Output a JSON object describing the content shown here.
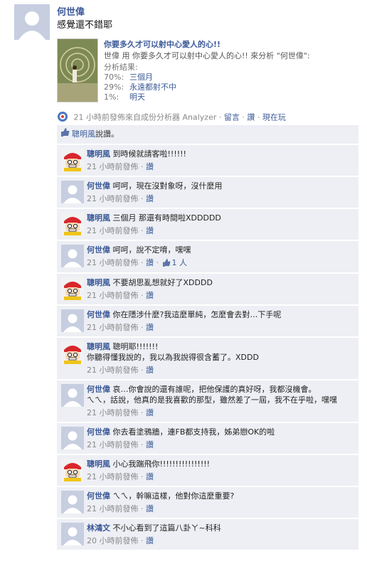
{
  "post": {
    "author": "何世偉",
    "status": "感覺還不錯耶",
    "attachment": {
      "title": "你要多久才可以射中心愛人的心!!",
      "description": "世偉 用 你要多久才可以射中心愛人的心!! 來分析 \"何世偉\":",
      "results_label": "分析結果:",
      "results": [
        {
          "pct": "70%:",
          "text": "三個月"
        },
        {
          "pct": "29%:",
          "text": "永遠都射不中"
        },
        {
          "pct": "1%:",
          "text": "明天"
        }
      ]
    },
    "meta": {
      "time": "21 小時前發佈來自成份分析器 Analyzer",
      "comment": "留言",
      "like": "讚",
      "play": "現在玩"
    }
  },
  "likes": {
    "name": "聰明風",
    "suffix": "說讚。"
  },
  "comments": [
    {
      "name": "聰明風",
      "avatar": "cartoon",
      "text": "到時候就請客啦!!!!!!",
      "time": "21 小時前發佈",
      "like": "讚",
      "likes": ""
    },
    {
      "name": "何世偉",
      "avatar": "default",
      "text": "呵呵，現在沒對象呀，沒什麼用",
      "time": "21 小時前發佈",
      "like": "讚",
      "likes": ""
    },
    {
      "name": "聰明風",
      "avatar": "cartoon",
      "text": "三個月 那還有時間啦XDDDDD",
      "time": "21 小時前發佈",
      "like": "讚",
      "likes": ""
    },
    {
      "name": "何世偉",
      "avatar": "default",
      "text": "呵呵，說不定唷，嘿嘿",
      "time": "21 小時前發佈",
      "like": "讚",
      "likes": "1 人"
    },
    {
      "name": "聰明風",
      "avatar": "cartoon",
      "text": "不要胡思亂想就好了XDDDD",
      "time": "21 小時前發佈",
      "like": "讚",
      "likes": ""
    },
    {
      "name": "何世偉",
      "avatar": "default",
      "text": "你在隱涉什麼?我這麼單純，怎麼會去對…下手呢",
      "time": "21 小時前發佈",
      "like": "讚",
      "likes": ""
    },
    {
      "name": "聰明風",
      "avatar": "cartoon",
      "text": "聰明耶!!!!!!!\n你聽得懂我說的，我以為我說得很含蓄了。XDDD",
      "time": "21 小時前發佈",
      "like": "讚",
      "likes": ""
    },
    {
      "name": "何世偉",
      "avatar": "default",
      "text": "哀…你會說的還有誰呢，把他保護的真好呀，我都沒機會。\nㄟㄟ，話說，他真的是我喜歡的那型，雖然差了一屆，我不在乎啦，嘿嘿",
      "time": "21 小時前發佈",
      "like": "讚",
      "likes": ""
    },
    {
      "name": "何世偉",
      "avatar": "default",
      "text": "你去看塗鴉牆，連FB都支持我，姊弟戀OK的啦",
      "time": "21 小時前發佈",
      "like": "讚",
      "likes": ""
    },
    {
      "name": "聰明風",
      "avatar": "cartoon",
      "text": "小心我踹飛你!!!!!!!!!!!!!!!!",
      "time": "21 小時前發佈",
      "like": "讚",
      "likes": ""
    },
    {
      "name": "何世偉",
      "avatar": "default",
      "text": "ㄟㄟ，幹嘛這樣，他對你這麼重要?",
      "time": "21 小時前發佈",
      "like": "讚",
      "likes": ""
    },
    {
      "name": "林鴻文",
      "avatar": "default",
      "text": "不小心看到了這篇八卦ㄚ~科科",
      "time": "20 小時前發佈",
      "like": "讚",
      "likes": ""
    }
  ]
}
